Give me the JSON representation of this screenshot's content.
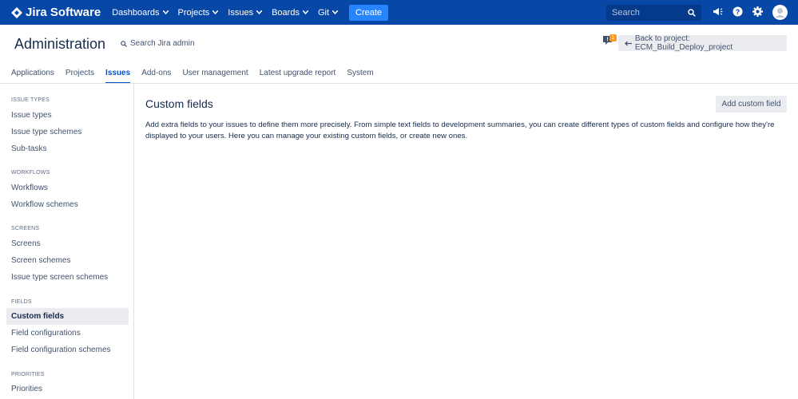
{
  "topnav": {
    "logo_text": "Jira Software",
    "items": [
      "Dashboards",
      "Projects",
      "Issues",
      "Boards",
      "Git"
    ],
    "create_label": "Create",
    "search_placeholder": "Search",
    "bg_color": "#0747a6"
  },
  "admin": {
    "title": "Administration",
    "search_label": "Search Jira admin",
    "notification_count": "1",
    "back_label": "Back to project: ECM_Build_Deploy_project",
    "tabs": [
      "Applications",
      "Projects",
      "Issues",
      "Add-ons",
      "User management",
      "Latest upgrade report",
      "System"
    ],
    "active_tab": "Issues"
  },
  "sidebar": {
    "sections": [
      {
        "heading": "ISSUE TYPES",
        "items": [
          "Issue types",
          "Issue type schemes",
          "Sub-tasks"
        ]
      },
      {
        "heading": "WORKFLOWS",
        "items": [
          "Workflows",
          "Workflow schemes"
        ]
      },
      {
        "heading": "SCREENS",
        "items": [
          "Screens",
          "Screen schemes",
          "Issue type screen schemes"
        ]
      },
      {
        "heading": "FIELDS",
        "items": [
          "Custom fields",
          "Field configurations",
          "Field configuration schemes"
        ]
      },
      {
        "heading": "PRIORITIES",
        "items": [
          "Priorities"
        ]
      }
    ],
    "selected": "Custom fields"
  },
  "main": {
    "title": "Custom fields",
    "add_button_label": "Add custom field",
    "description": "Add extra fields to your issues to define them more precisely. From simple text fields to development summaries, you can create different types of custom fields and configure how they're displayed to your users. Here you can manage your existing custom fields, or create new ones."
  }
}
